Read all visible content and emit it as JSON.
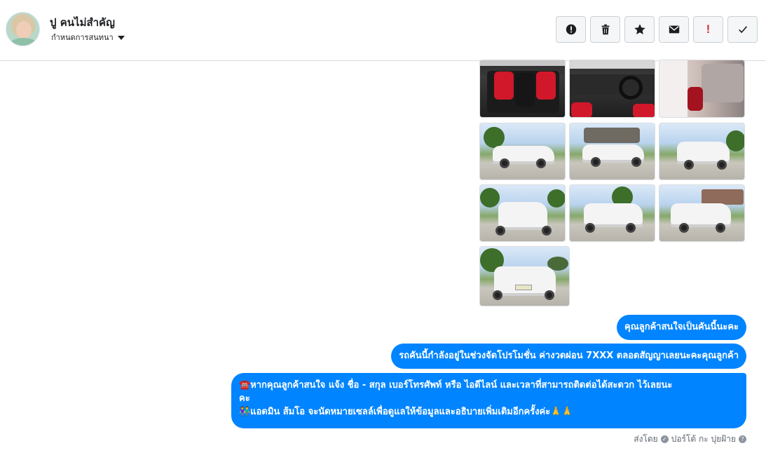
{
  "header": {
    "name": "ปู คนไม่สำคัญ",
    "status_label": "กำหนดการสนทนา",
    "toolbar": {
      "icons": [
        "alert-circle-icon",
        "trash-icon",
        "star-icon",
        "envelope-icon",
        "exclamation-icon",
        "checkmark-icon"
      ],
      "colors": {
        "exclamation": "#e02e2e"
      }
    }
  },
  "conversation": {
    "photo_count": 10,
    "messages": [
      {
        "text": "คุณลูกค้าสนใจเป็นคันนี้นะคะ"
      },
      {
        "text": "รถคันนี้กำลังอยู่ในช่วงจัดโปรโมชั่น ค่างวดผ่อน 7XXX ตลอดสัญญาเลยนะคะคุณลูกค้า"
      },
      {
        "line1": "☎️หากคุณลูกค้าสนใจ แจ้ง ชื่อ - สกุล เบอร์โทรศัพท์ หรือ ไอดีไลน์ และเวลาที่สามารถติดต่อได้สะดวก ไว้เลยนะ",
        "line2": "คะ",
        "line3": "👫แอดมิน ส้มโอ จะนัดหมายเซลล์เพื่อดูแลให้ข้อมูลและอธิบายเพิ่มเติมอีกครั้งค่ะ🙏🙏"
      }
    ],
    "sent_by_label": "ส่งโดย",
    "sender": "ปอร์โต้ กะ ปุยฝ้าย",
    "bubble_color": "#0084ff"
  }
}
